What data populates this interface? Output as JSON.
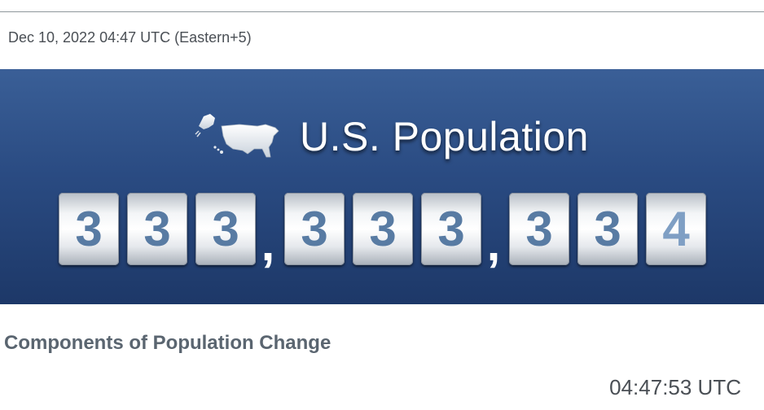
{
  "header": {
    "timestamp": "Dec 10, 2022 04:47 UTC (Eastern+5)"
  },
  "banner": {
    "title": "U.S. Population",
    "icon": "us-map-icon",
    "digits": [
      "3",
      "3",
      "3",
      "3",
      "3",
      "3",
      "3",
      "3",
      "4"
    ],
    "separator": ",",
    "background_color": "#2a4b82",
    "digit_color": "#587ba3"
  },
  "components": {
    "heading": "Components of Population Change",
    "clock": "04:47:53 UTC"
  }
}
